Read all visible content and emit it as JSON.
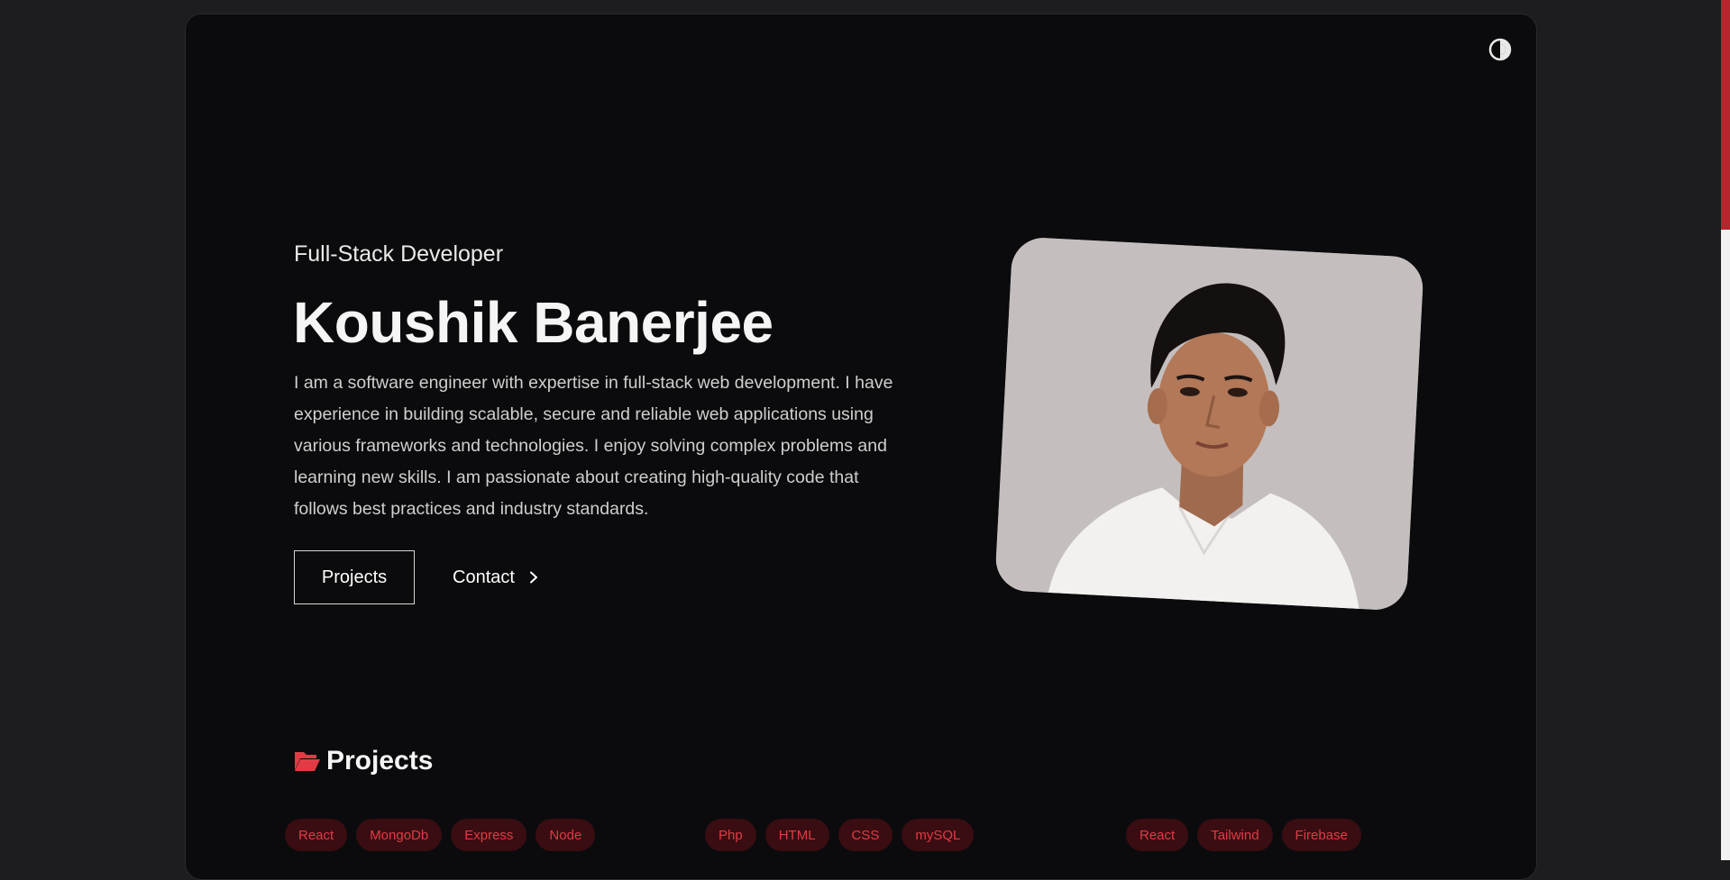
{
  "hero": {
    "subtitle": "Full-Stack Developer",
    "name": "Koushik Banerjee",
    "bio": "I am a software engineer with expertise in full-stack web development. I have experience in building scalable, secure and reliable web applications using various frameworks and technologies. I enjoy solving complex problems and learning new skills. I am passionate about creating high-quality code that follows best practices and industry standards.",
    "buttons": {
      "projects_label": "Projects",
      "contact_label": "Contact"
    },
    "photo_icon": "portrait-photo"
  },
  "header": {
    "theme_toggle_icon": "contrast-icon"
  },
  "projects": {
    "title": "Projects",
    "icon": "folder-open-icon",
    "cards": [
      {
        "tags": [
          "React",
          "MongoDb",
          "Express",
          "Node"
        ]
      },
      {
        "tags": [
          "Php",
          "HTML",
          "CSS",
          "mySQL"
        ]
      },
      {
        "tags": [
          "React",
          "Tailwind",
          "Firebase"
        ]
      }
    ]
  },
  "colors": {
    "page_background": "#1d1d1f",
    "card_background": "#0b0b0d",
    "accent": "#e23b45",
    "tag_background": "#3a0d12",
    "scrollbar_thumb": "#b3282d"
  }
}
